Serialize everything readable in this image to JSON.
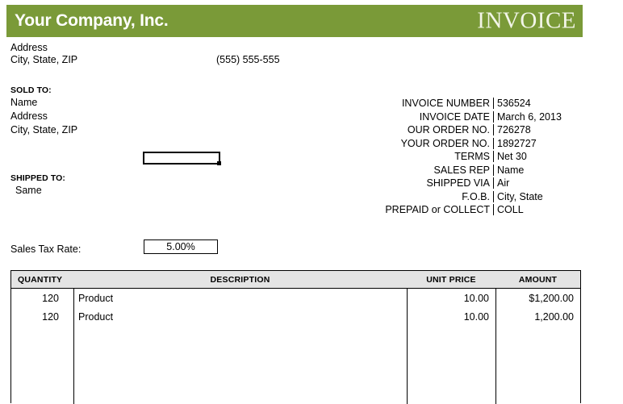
{
  "header": {
    "company_name": "Your Company, Inc.",
    "invoice_word": "INVOICE",
    "bar_color": "#7a9a38"
  },
  "company": {
    "address": "Address",
    "city_state_zip": "City, State, ZIP",
    "phone": "(555) 555-555"
  },
  "sold_to": {
    "label": "SOLD TO:",
    "name": "Name",
    "address": "Address",
    "city_state_zip": "City, State, ZIP"
  },
  "shipped_to": {
    "label": "SHIPPED TO:",
    "value": "Same"
  },
  "sales_tax": {
    "label": "Sales Tax Rate:",
    "value": "5.00%"
  },
  "meta": {
    "rows": [
      {
        "label": "INVOICE NUMBER",
        "value": "536524"
      },
      {
        "label": "INVOICE DATE",
        "value": "March 6, 2013"
      },
      {
        "label": "OUR ORDER NO.",
        "value": "726278"
      },
      {
        "label": "YOUR ORDER NO.",
        "value": "1892727"
      },
      {
        "label": "TERMS",
        "value": "Net 30"
      },
      {
        "label": "SALES REP",
        "value": "Name"
      },
      {
        "label": "SHIPPED VIA",
        "value": "Air"
      },
      {
        "label": "F.O.B.",
        "value": "City, State"
      },
      {
        "label": "PREPAID or COLLECT",
        "value": "COLL"
      }
    ]
  },
  "items": {
    "columns": {
      "quantity": "QUANTITY",
      "description": "DESCRIPTION",
      "unit_price": "UNIT PRICE",
      "amount": "AMOUNT"
    },
    "header_bg": "#e4e4e4",
    "rows": [
      {
        "quantity": "120",
        "description": "Product",
        "unit_price": "10.00",
        "amount": "$1,200.00"
      },
      {
        "quantity": "120",
        "description": "Product",
        "unit_price": "10.00",
        "amount": "1,200.00"
      }
    ]
  }
}
